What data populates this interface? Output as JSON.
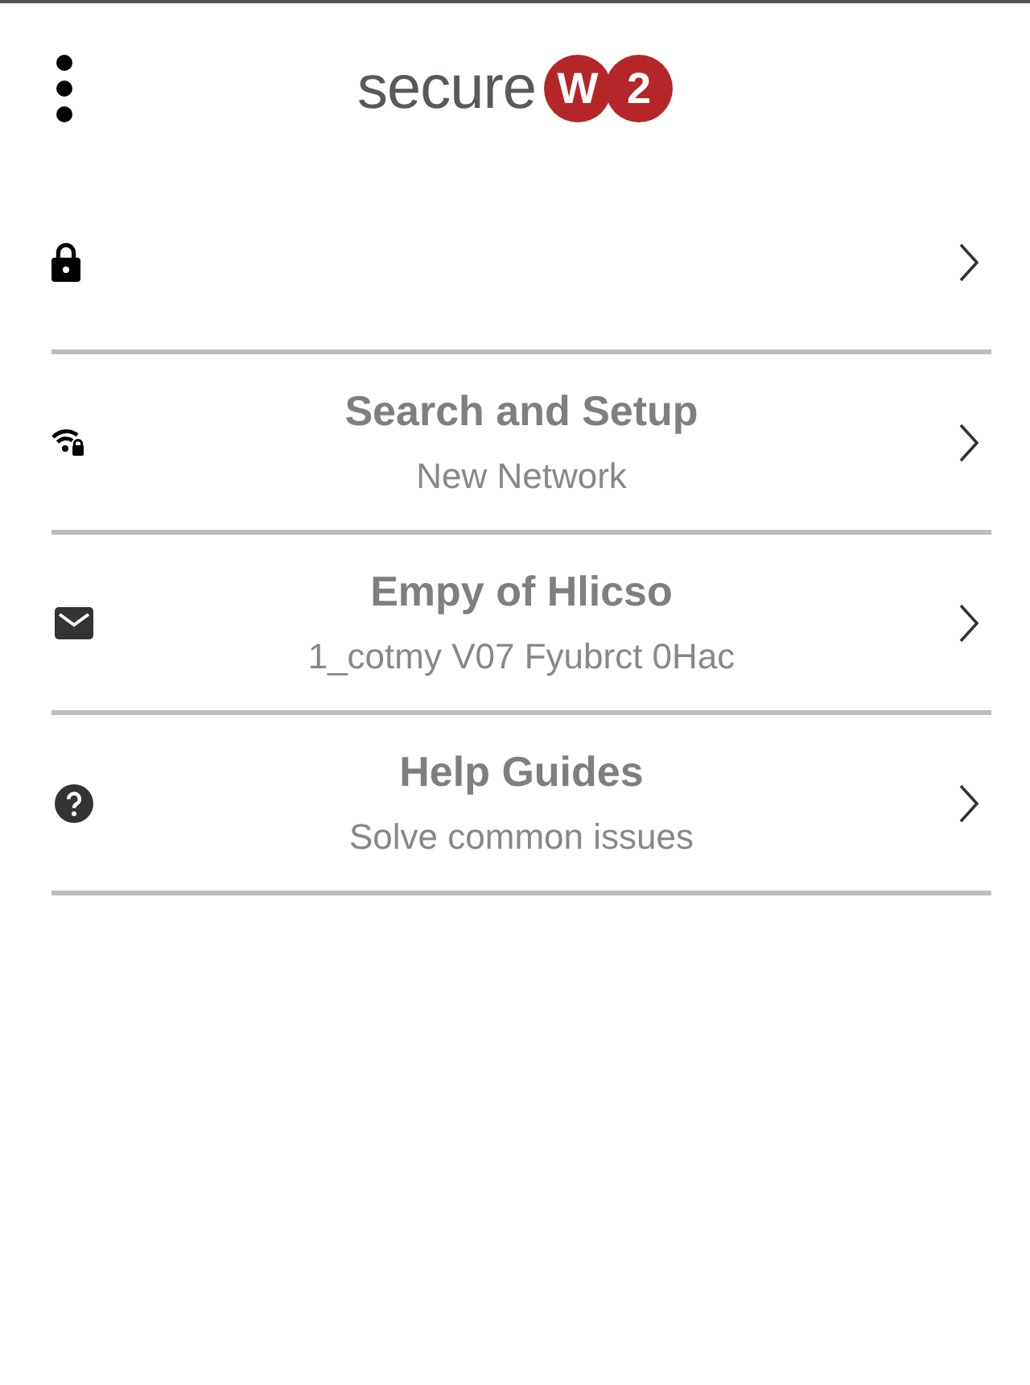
{
  "header": {
    "logo": {
      "text": "secure",
      "badges": [
        "W",
        "2"
      ]
    }
  },
  "menu_items": [
    {
      "kind": "icon_only"
    },
    {
      "kind": "labeled",
      "title": "Search and Setup",
      "subtitle": "New Network"
    },
    {
      "kind": "labeled",
      "title": "Empy of Hlicso",
      "subtitle": "1_cotmy V07 Fyubrct 0Hac"
    },
    {
      "kind": "labeled",
      "title": "Help Guides",
      "subtitle": "Solve common issues"
    }
  ]
}
